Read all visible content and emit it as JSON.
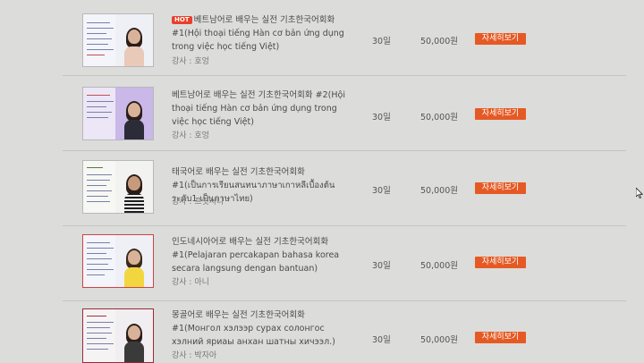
{
  "courses": [
    {
      "badge": "HOT",
      "title": "베트남어로 배우는 실전 기초한국어회화 #1(Hội thoại tiếng Hàn cơ bản ứng dụng trong việc học tiếng Việt)",
      "teacher": "강사 : 호엉",
      "days": "30일",
      "price": "50,000원",
      "button": "자세히보기"
    },
    {
      "title": "베트남어로 배우는 실전 기초한국어회화 #2(Hội thoại tiếng Hàn cơ bản ứng dụng trong việc học tiếng Việt)",
      "teacher": "강사 : 호엉",
      "days": "30일",
      "price": "50,000원",
      "button": "자세히보기"
    },
    {
      "title": "태국어로 배우는 실전 기초한국어회화 #1(เป็นการเรียนสนทนาภาษาเกาหลีเบื้องต้นระดับ1 เป็นภาษาไทย)",
      "teacher": "강사 : 프릿사나",
      "days": "30일",
      "price": "50,000원",
      "button": "자세히보기"
    },
    {
      "title": "인도네시아어로 배우는 실전 기초한국어회화 #1(Pelajaran percakapan bahasa korea secara langsung dengan bantuan)",
      "teacher": "강사 : 아니",
      "days": "30일",
      "price": "50,000원",
      "button": "자세히보기"
    },
    {
      "title": "몽골어로 배우는 실전 기초한국어회화 #1(Монгол хэлээр сурах солонгос хэлний яриаы анхан шатны хичээл.)",
      "teacher": "강사 : 박자아",
      "days": "30일",
      "price": "50,000원",
      "button": "자세히보기"
    }
  ]
}
